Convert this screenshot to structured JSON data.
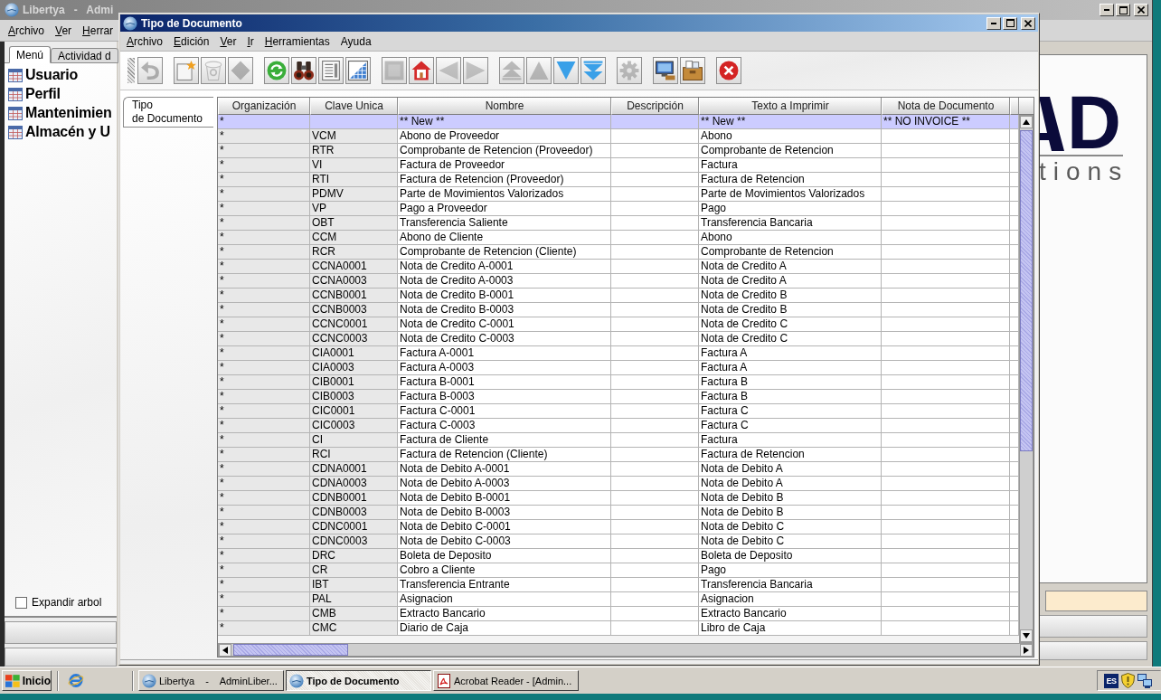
{
  "background_window": {
    "title": "Libertya   -   Admi",
    "menu": [
      {
        "label": "Archivo",
        "mnemonic": true
      },
      {
        "label": "Ver",
        "mnemonic": true
      },
      {
        "label": "Herrar",
        "mnemonic": true
      }
    ],
    "tabs": [
      {
        "label": "Menú",
        "selected": true
      },
      {
        "label": "Actividad d",
        "selected": false
      }
    ],
    "tree": [
      {
        "label": "Usuario"
      },
      {
        "label": "Perfil"
      },
      {
        "label": "Mantenimien"
      },
      {
        "label": "Almacén y U"
      }
    ],
    "expand_tree": {
      "label": "Expandir arbol",
      "checked": false
    },
    "logo": {
      "letter": "D",
      "tagline": "tions"
    }
  },
  "window": {
    "title": "Tipo de Documento",
    "menu": [
      {
        "label": "Archivo",
        "mnemonic": true
      },
      {
        "label": "Edición",
        "mnemonic": true
      },
      {
        "label": "Ver",
        "mnemonic": true
      },
      {
        "label": "Ir",
        "mnemonic": true
      },
      {
        "label": "Herramientas",
        "mnemonic": true
      },
      {
        "label": "Ayuda",
        "mnemonic": false
      }
    ],
    "toolbar": {
      "groups": [
        {
          "buttons": [
            {
              "kind": "undo",
              "disabled": true
            }
          ]
        },
        {
          "buttons": [
            {
              "kind": "new",
              "disabled": false
            },
            {
              "kind": "delete",
              "disabled": true
            },
            {
              "kind": "save",
              "disabled": true
            }
          ]
        },
        {
          "buttons": [
            {
              "kind": "refresh",
              "disabled": false
            },
            {
              "kind": "find",
              "disabled": false
            },
            {
              "kind": "detail",
              "disabled": false
            },
            {
              "kind": "grid",
              "disabled": false
            }
          ]
        },
        {
          "buttons": [
            {
              "kind": "parent",
              "disabled": true
            },
            {
              "kind": "home",
              "disabled": false
            },
            {
              "kind": "back",
              "disabled": true
            },
            {
              "kind": "forward",
              "disabled": true
            }
          ]
        },
        {
          "buttons": [
            {
              "kind": "first",
              "disabled": true
            },
            {
              "kind": "previous",
              "disabled": true
            },
            {
              "kind": "next",
              "disabled": false
            },
            {
              "kind": "last",
              "disabled": false
            }
          ]
        },
        {
          "buttons": [
            {
              "kind": "process",
              "disabled": true
            }
          ]
        },
        {
          "buttons": [
            {
              "kind": "export",
              "disabled": false
            },
            {
              "kind": "archive",
              "disabled": false
            }
          ]
        },
        {
          "buttons": [
            {
              "kind": "exit",
              "disabled": false
            }
          ]
        }
      ]
    },
    "tabs": [
      {
        "label": "Tipo\nde Documento",
        "selected": true
      }
    ],
    "table": {
      "columns": [
        {
          "label": "Organización",
          "read_only": true
        },
        {
          "label": "Clave Unica",
          "read_only": true
        },
        {
          "label": "Nombre",
          "read_only": false
        },
        {
          "label": "Descripción",
          "read_only": false
        },
        {
          "label": "Texto a Imprimir",
          "read_only": false
        },
        {
          "label": "Nota de Documento",
          "read_only": false
        },
        {
          "read_only": false
        }
      ],
      "rows": [
        {
          "selected": true,
          "organization": "*",
          "name": "** New **",
          "print_text": "** New **",
          "document_note": "** NO INVOICE **"
        },
        {
          "selected": false,
          "organization": "*",
          "key": "VCM",
          "name": "Abono de Proveedor",
          "print_text": "Abono"
        },
        {
          "selected": false,
          "organization": "*",
          "key": "RTR",
          "name": "Comprobante de Retencion (Proveedor)",
          "print_text": "Comprobante de Retencion"
        },
        {
          "selected": false,
          "organization": "*",
          "key": "VI",
          "name": "Factura de Proveedor",
          "print_text": "Factura"
        },
        {
          "selected": false,
          "organization": "*",
          "key": "RTI",
          "name": "Factura de Retencion (Proveedor)",
          "print_text": "Factura de Retencion"
        },
        {
          "selected": false,
          "organization": "*",
          "key": "PDMV",
          "name": "Parte de Movimientos Valorizados",
          "print_text": "Parte de Movimientos Valorizados"
        },
        {
          "selected": false,
          "organization": "*",
          "key": "VP",
          "name": "Pago a Proveedor",
          "print_text": "Pago"
        },
        {
          "selected": false,
          "organization": "*",
          "key": "OBT",
          "name": "Transferencia Saliente",
          "print_text": "Transferencia Bancaria"
        },
        {
          "selected": false,
          "organization": "*",
          "key": "CCM",
          "name": "Abono de Cliente",
          "print_text": "Abono"
        },
        {
          "selected": false,
          "organization": "*",
          "key": "RCR",
          "name": "Comprobante de Retencion (Cliente)",
          "print_text": "Comprobante de Retencion"
        },
        {
          "selected": false,
          "organization": "*",
          "key": "CCNA0001",
          "name": "Nota de Credito A-0001",
          "print_text": "Nota de Credito A"
        },
        {
          "selected": false,
          "organization": "*",
          "key": "CCNA0003",
          "name": "Nota de Credito A-0003",
          "print_text": "Nota de Credito A"
        },
        {
          "selected": false,
          "organization": "*",
          "key": "CCNB0001",
          "name": "Nota de Credito B-0001",
          "print_text": "Nota de Credito B"
        },
        {
          "selected": false,
          "organization": "*",
          "key": "CCNB0003",
          "name": "Nota de Credito B-0003",
          "print_text": "Nota de Credito B"
        },
        {
          "selected": false,
          "organization": "*",
          "key": "CCNC0001",
          "name": "Nota de Credito C-0001",
          "print_text": "Nota de Credito C"
        },
        {
          "selected": false,
          "organization": "*",
          "key": "CCNC0003",
          "name": "Nota de Credito C-0003",
          "print_text": "Nota de Credito C"
        },
        {
          "selected": false,
          "organization": "*",
          "key": "CIA0001",
          "name": "Factura A-0001",
          "print_text": "Factura A"
        },
        {
          "selected": false,
          "organization": "*",
          "key": "CIA0003",
          "name": "Factura A-0003",
          "print_text": "Factura A"
        },
        {
          "selected": false,
          "organization": "*",
          "key": "CIB0001",
          "name": "Factura B-0001",
          "print_text": "Factura B"
        },
        {
          "selected": false,
          "organization": "*",
          "key": "CIB0003",
          "name": "Factura B-0003",
          "print_text": "Factura B"
        },
        {
          "selected": false,
          "organization": "*",
          "key": "CIC0001",
          "name": "Factura C-0001",
          "print_text": "Factura C"
        },
        {
          "selected": false,
          "organization": "*",
          "key": "CIC0003",
          "name": "Factura C-0003",
          "print_text": "Factura C"
        },
        {
          "selected": false,
          "organization": "*",
          "key": "CI",
          "name": "Factura de Cliente",
          "print_text": "Factura"
        },
        {
          "selected": false,
          "organization": "*",
          "key": "RCI",
          "name": "Factura de Retencion (Cliente)",
          "print_text": "Factura de Retencion"
        },
        {
          "selected": false,
          "organization": "*",
          "key": "CDNA0001",
          "name": "Nota de Debito A-0001",
          "print_text": "Nota de Debito A"
        },
        {
          "selected": false,
          "organization": "*",
          "key": "CDNA0003",
          "name": "Nota de Debito A-0003",
          "print_text": "Nota de Debito A"
        },
        {
          "selected": false,
          "organization": "*",
          "key": "CDNB0001",
          "name": "Nota de Debito B-0001",
          "print_text": "Nota de Debito B"
        },
        {
          "selected": false,
          "organization": "*",
          "key": "CDNB0003",
          "name": "Nota de Debito B-0003",
          "print_text": "Nota de Debito B"
        },
        {
          "selected": false,
          "organization": "*",
          "key": "CDNC0001",
          "name": "Nota de Debito C-0001",
          "print_text": "Nota de Debito C"
        },
        {
          "selected": false,
          "organization": "*",
          "key": "CDNC0003",
          "name": "Nota de Debito C-0003",
          "print_text": "Nota de Debito C"
        },
        {
          "selected": false,
          "organization": "*",
          "key": "DRC",
          "name": "Boleta de Deposito",
          "print_text": "Boleta de Deposito"
        },
        {
          "selected": false,
          "organization": "*",
          "key": "CR",
          "name": "Cobro a Cliente",
          "print_text": "Pago"
        },
        {
          "selected": false,
          "organization": "*",
          "key": "IBT",
          "name": "Transferencia Entrante",
          "print_text": "Transferencia Bancaria"
        },
        {
          "selected": false,
          "organization": "*",
          "key": "PAL",
          "name": "Asignacion",
          "print_text": "Asignacion"
        },
        {
          "selected": false,
          "organization": "*",
          "key": "CMB",
          "name": "Extracto Bancario",
          "print_text": "Extracto Bancario"
        },
        {
          "selected": false,
          "organization": "*",
          "key": "CMC",
          "name": "Diario de Caja",
          "print_text": "Libro de Caja"
        }
      ]
    }
  },
  "taskbar": {
    "start": "Inicio",
    "tasks": [
      {
        "kind": "app",
        "label": "Libertya    -    AdminLiber...",
        "selected": false
      },
      {
        "kind": "app",
        "label": "Tipo de Documento",
        "selected": true
      },
      {
        "kind": "pdf",
        "label": "Acrobat Reader - [Admin...",
        "selected": false
      }
    ],
    "language": "ES"
  }
}
